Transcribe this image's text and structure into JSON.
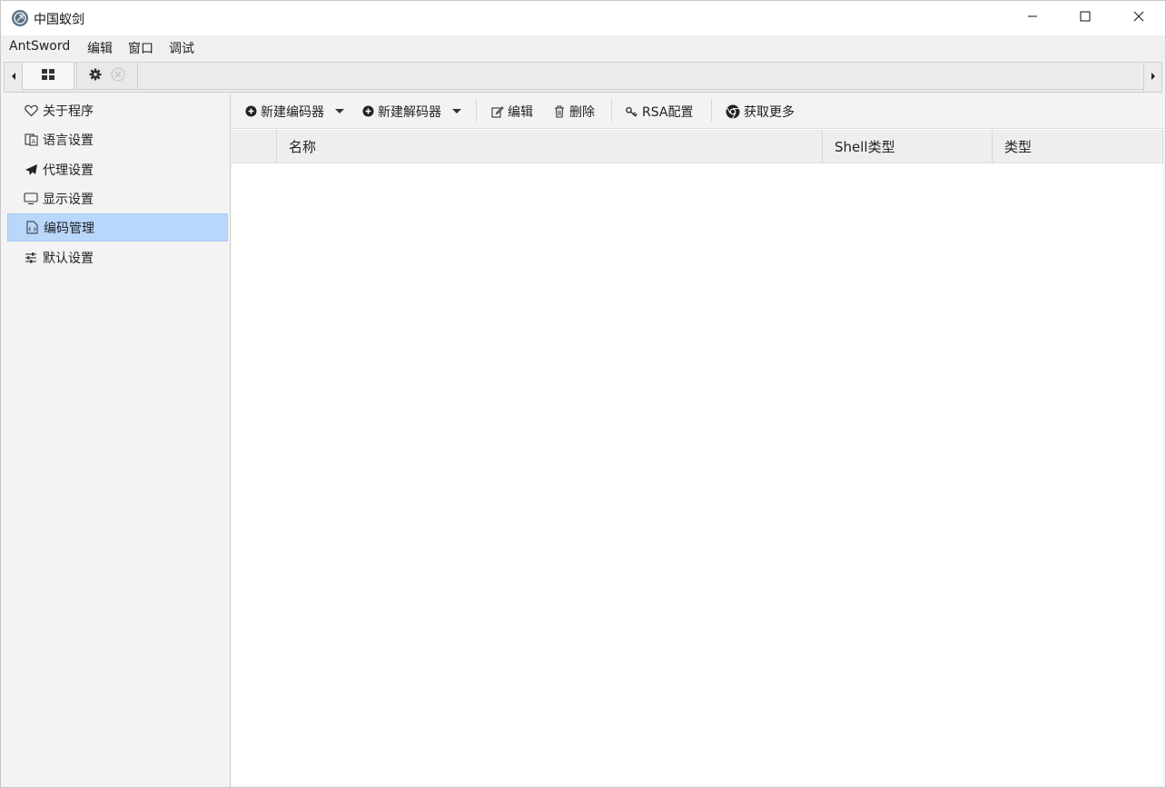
{
  "window": {
    "title": "中国蚁剑",
    "icon": "antsword-logo-icon",
    "controls": [
      "minimize-icon",
      "maximize-icon",
      "close-icon"
    ]
  },
  "menubar": {
    "items": [
      "AntSword",
      "编辑",
      "窗口",
      "调试"
    ]
  },
  "tabs": {
    "items": [
      {
        "icon": "grid-icon"
      },
      {
        "icon": "gear-icon",
        "close_icon": "close-circle-icon"
      }
    ]
  },
  "sidebar": {
    "items": [
      {
        "label": "关于程序",
        "icon": "heart-icon"
      },
      {
        "label": "语言设置",
        "icon": "language-icon"
      },
      {
        "label": "代理设置",
        "icon": "paper-plane-icon"
      },
      {
        "label": "显示设置",
        "icon": "monitor-icon"
      },
      {
        "label": "编码管理",
        "icon": "code-file-icon",
        "active": true
      },
      {
        "label": "默认设置",
        "icon": "sliders-icon"
      }
    ]
  },
  "toolbar": {
    "new_encoder": "新建编码器",
    "new_decoder": "新建解码器",
    "edit": "编辑",
    "delete": "删除",
    "rsa_config": "RSA配置",
    "get_more": "获取更多"
  },
  "grid": {
    "columns": [
      "",
      "名称",
      "Shell类型",
      "类型"
    ],
    "rows": []
  },
  "colors": {
    "active_sidebar": "#b9d6fb",
    "toolbar_bg": "#f3f3f3",
    "header_bg": "#eeeeee"
  }
}
